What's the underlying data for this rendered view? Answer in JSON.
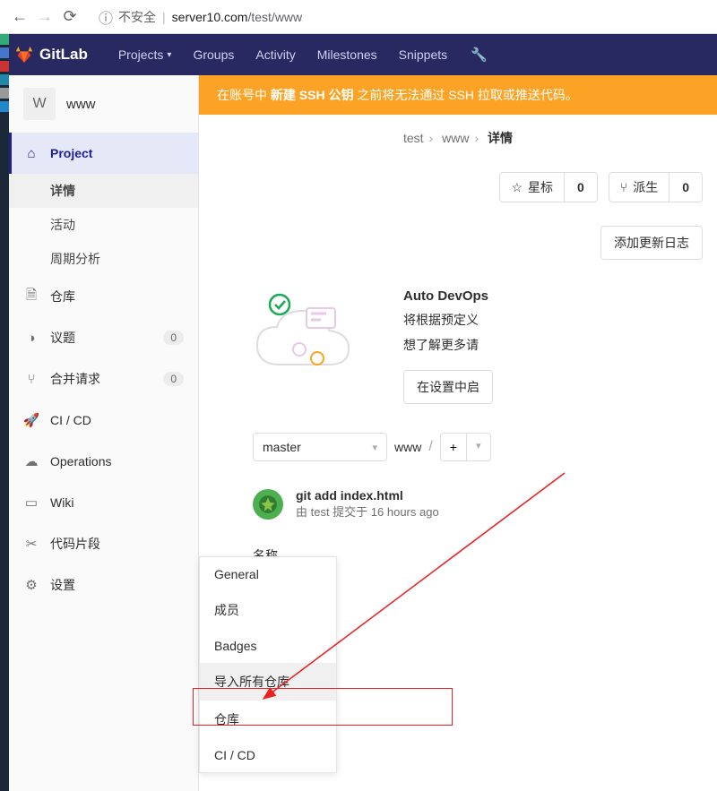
{
  "browser": {
    "insecure_label": "不安全",
    "url_host": "server10.com",
    "url_path": "/test/www"
  },
  "header": {
    "brand": "GitLab",
    "nav": [
      "Projects",
      "Groups",
      "Activity",
      "Milestones",
      "Snippets"
    ]
  },
  "project": {
    "initial": "W",
    "name": "www"
  },
  "sidebar": {
    "project": "Project",
    "project_subs": [
      "详情",
      "活动",
      "周期分析"
    ],
    "repo": "仓库",
    "issues": "议题",
    "issues_count": "0",
    "mr": "合并请求",
    "mr_count": "0",
    "cicd": "CI / CD",
    "ops": "Operations",
    "wiki": "Wiki",
    "snippets": "代码片段",
    "settings": "设置"
  },
  "banner": {
    "p1": "在账号中 ",
    "p2": "新建 SSH 公钥 ",
    "p3": "之前将无法通过 SSH 拉取或推送代码。"
  },
  "breadcrumb": {
    "a": "test",
    "b": "www",
    "c": "详情"
  },
  "stats": {
    "star": "星标",
    "star_n": "0",
    "fork": "派生",
    "fork_n": "0"
  },
  "changelog_btn": "添加更新日志",
  "devops": {
    "title": "Auto DevOps",
    "line1": "将根据预定义",
    "line2": "想了解更多请",
    "btn": "在设置中启"
  },
  "branch": {
    "name": "master",
    "crumb": "www"
  },
  "commit": {
    "title": "git add index.html",
    "meta": "由 test 提交于 16 hours ago"
  },
  "name_label": "名称",
  "flyout": [
    "General",
    "成员",
    "Badges",
    "导入所有仓库",
    "仓库",
    "CI / CD"
  ]
}
